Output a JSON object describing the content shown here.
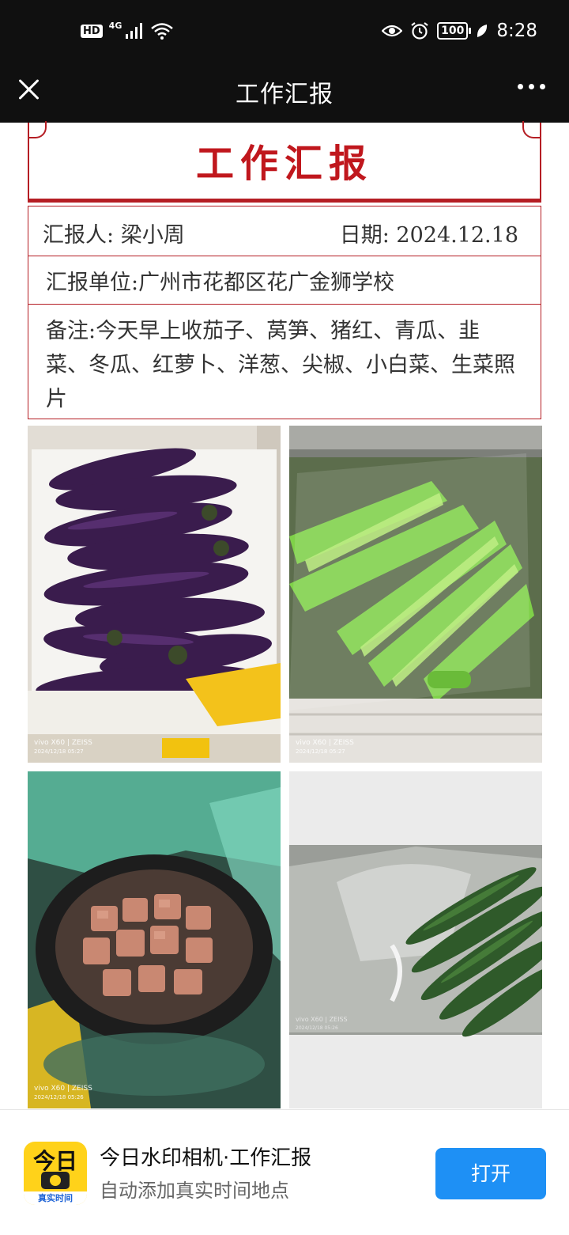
{
  "status_bar": {
    "hd": "HD",
    "network": "4G",
    "battery": "100",
    "time": "8:28"
  },
  "header": {
    "title": "工作汇报"
  },
  "report": {
    "title": "工作汇报",
    "reporter_label": "汇报人:",
    "reporter": "梁小周",
    "date_label": "日期:",
    "date": "2024.12.18",
    "unit_label": "汇报单位:",
    "unit": "广州市花都区花广金狮学校",
    "note_label": "备注:",
    "note": "今天早上收茄子、莴笋、猪红、青瓜、韭菜、冬瓜、红萝卜、洋葱、尖椒、小白菜、生菜照片"
  },
  "photos": [
    {
      "subject": "茄子",
      "watermark_brand": "vivo X60 | ZEISS",
      "watermark_time": "2024/12/18 05:27"
    },
    {
      "subject": "莴笋",
      "watermark_brand": "vivo X60 | ZEISS",
      "watermark_time": "2024/12/18 05:27"
    },
    {
      "subject": "猪红",
      "watermark_brand": "vivo X60 | ZEISS",
      "watermark_time": "2024/12/18 05:26"
    },
    {
      "subject": "青瓜",
      "watermark_brand": "vivo X60 | ZEISS",
      "watermark_time": "2024/12/18 05:26"
    }
  ],
  "banner": {
    "icon_text": "今日",
    "icon_sub": "真实时间",
    "app_name": "今日水印相机·工作汇报",
    "app_desc": "自动添加真实时间地点",
    "open_label": "打开"
  },
  "colors": {
    "accent_red": "#b51e24",
    "title_red": "#c0171d",
    "button_blue": "#1e90f5",
    "icon_yellow": "#ffd21a"
  }
}
